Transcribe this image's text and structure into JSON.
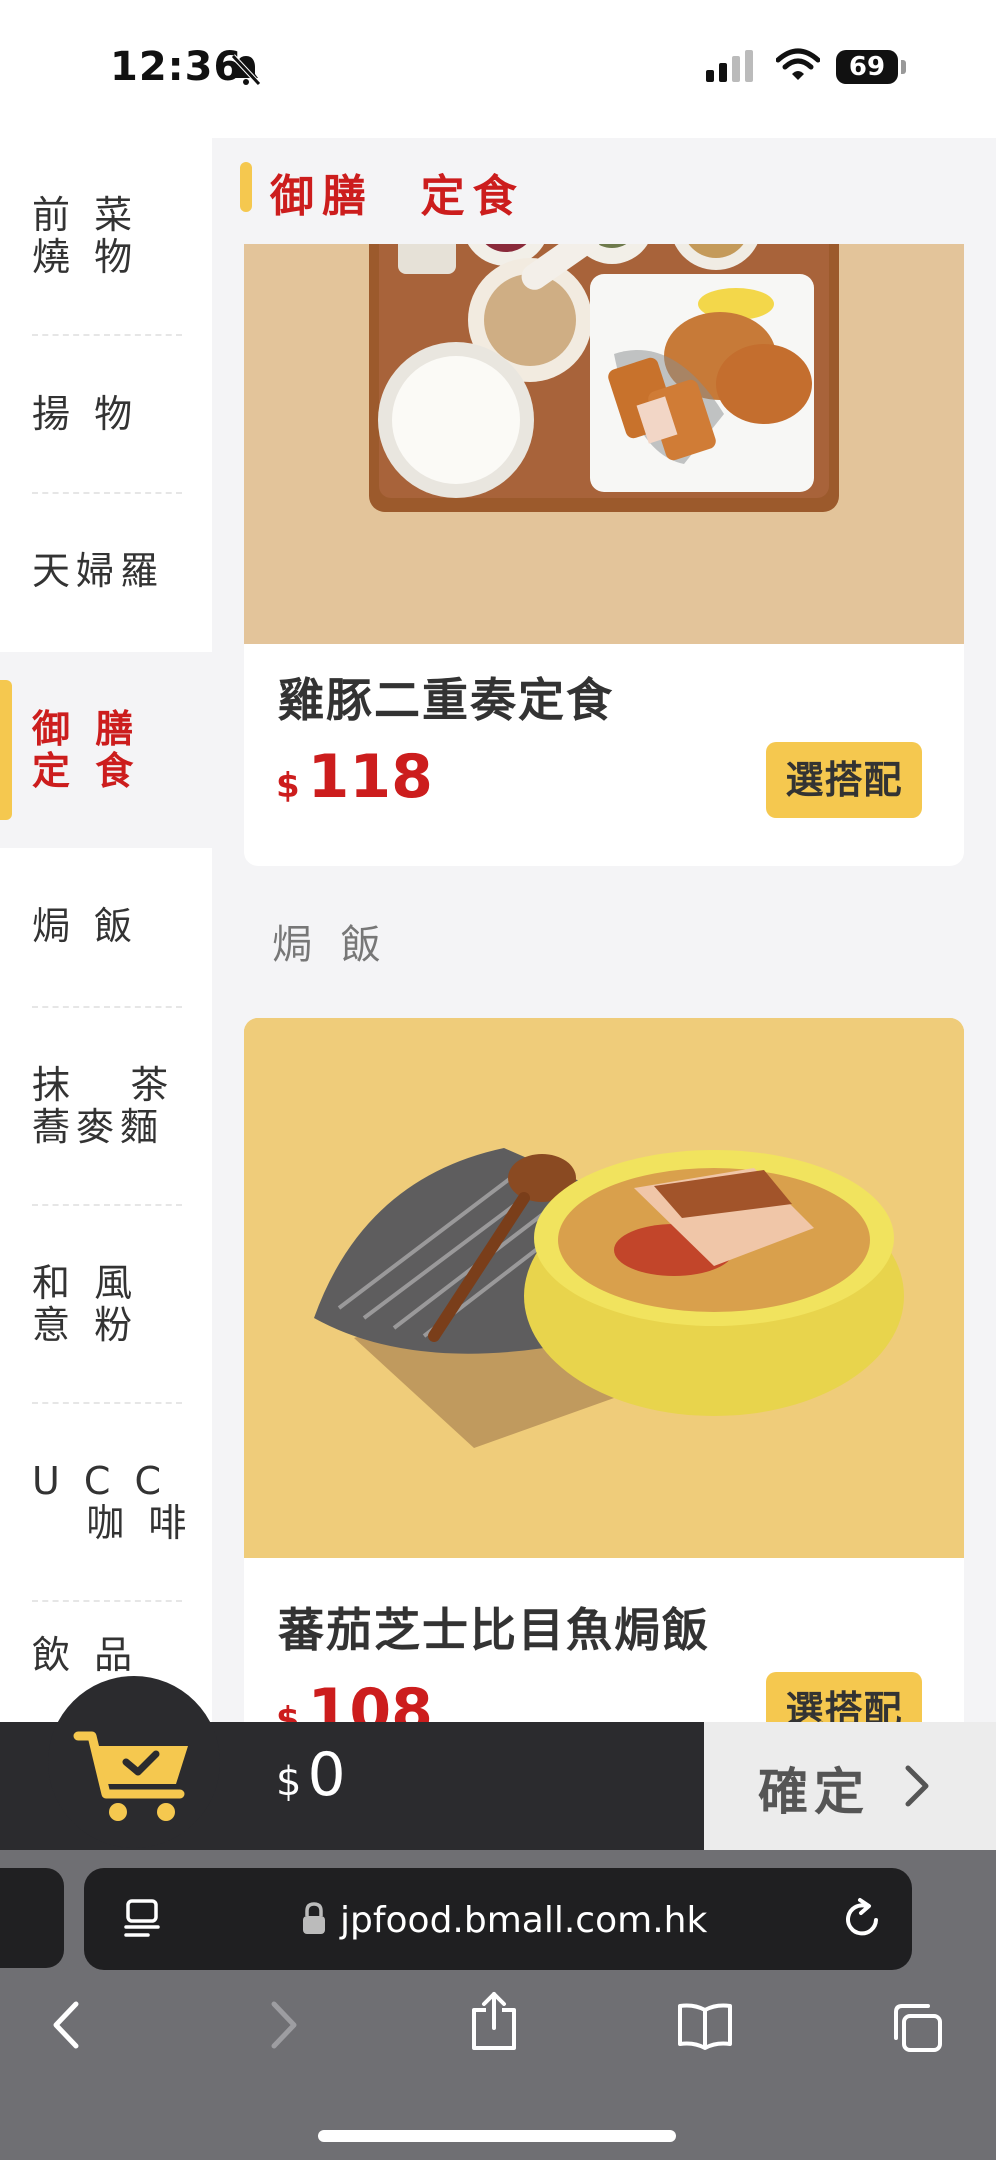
{
  "status_bar": {
    "time": "12:36",
    "battery": "69"
  },
  "sidebar": {
    "items": [
      {
        "label": "前 菜\n燒 物",
        "active": false
      },
      {
        "label": "揚 物",
        "active": false
      },
      {
        "label": "天婦羅",
        "active": false
      },
      {
        "label": "御 膳\n定 食",
        "active": true
      },
      {
        "label": "焗 飯",
        "active": false
      },
      {
        "label": "抹   茶\n蕎麥麵",
        "active": false
      },
      {
        "label": "和 風\n意 粉",
        "active": false
      },
      {
        "label": "U C C\n   咖 啡",
        "active": false
      },
      {
        "label": "飲 品",
        "active": false
      }
    ]
  },
  "main": {
    "section_title": "御膳  定食",
    "products": [
      {
        "name": "雞豚二重奏定食",
        "currency": "$",
        "price": "118",
        "option_button": "選搭配"
      },
      {
        "name": "蕃茄芝士比目魚焗飯",
        "currency": "$",
        "price": "108",
        "option_button": "選搭配"
      }
    ],
    "subsection_title": "焗 飯"
  },
  "cart": {
    "currency": "$",
    "total": "0",
    "confirm_label": "確定",
    "icon": "cart-icon"
  },
  "browser": {
    "url": "jpfood.bmall.com.hk"
  },
  "colors": {
    "accent_red": "#cc1d1d",
    "accent_yellow": "#f5c84f",
    "cart_bar": "#2b2b2e"
  }
}
